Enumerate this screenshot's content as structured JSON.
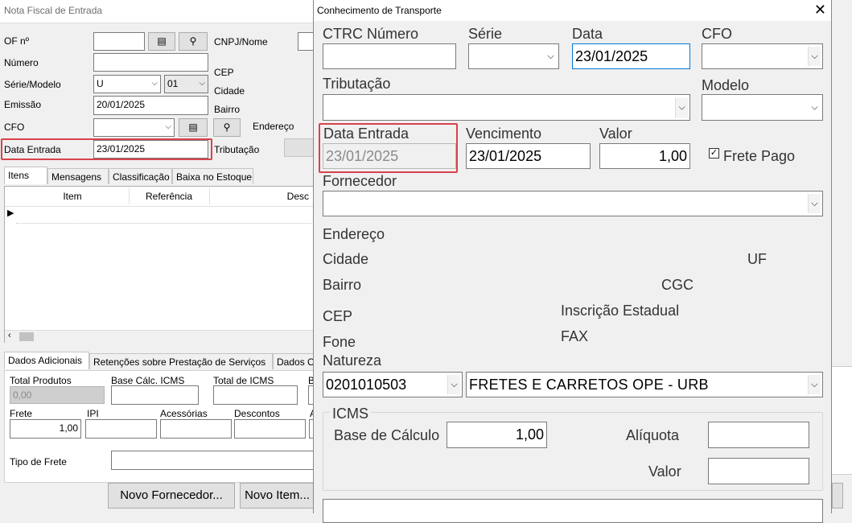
{
  "bg": {
    "title": "Nota Fiscal de Entrada",
    "of_label": "OF nº",
    "numero_label": "Número",
    "serie_label": "Série/Modelo",
    "serie_value": "U",
    "modelo_value": "01",
    "emissao_label": "Emissão",
    "emissao_value": "20/01/2025",
    "cfo_label": "CFO",
    "data_entrada_label": "Data Entrada",
    "data_entrada_value": "23/01/2025",
    "cnpj_label": "CNPJ/Nome",
    "cep_label": "CEP",
    "cidade_label": "Cidade",
    "bairro_label": "Bairro",
    "endereco_label": "Endereço",
    "tributacao_label": "Tributação",
    "tabs": [
      "Itens",
      "Mensagens",
      "Classificação",
      "Baixa no Estoque"
    ],
    "grid_headers": [
      "Item",
      "Referência",
      "Desc"
    ],
    "bottom_tabs": [
      "Dados Adicionais",
      "Retenções sobre Prestação de Serviços",
      "Dados C"
    ],
    "total_produtos_label": "Total Produtos",
    "total_produtos_value": "0,00",
    "base_icms_label": "Base Cálc. ICMS",
    "total_icms_label": "Total de ICMS",
    "b_label": "B",
    "frete_label": "Frete",
    "frete_value": "1,00",
    "ipi_label": "IPI",
    "acessorias_label": "Acessórias",
    "descontos_label": "Descontos",
    "a_label": "A",
    "tipo_frete_label": "Tipo de Frete",
    "novo_fornecedor": "Novo Fornecedor...",
    "novo_item": "Novo Item..."
  },
  "dialog": {
    "title": "Conhecimento de Transporte",
    "close_glyph": "✕",
    "ctrc_label": "CTRC Número",
    "ctrc_value": "",
    "serie_label": "Série",
    "serie_value": "",
    "data_label": "Data",
    "data_value": "23/01/2025",
    "cfo_label": "CFO",
    "cfo_value": "",
    "tributacao_label": "Tributação",
    "modelo_label": "Modelo",
    "data_entrada_label": "Data Entrada",
    "data_entrada_value": "23/01/2025",
    "vencimento_label": "Vencimento",
    "vencimento_value": "23/01/2025",
    "valor_label": "Valor",
    "valor_value": "1,00",
    "frete_pago_label": "Frete Pago",
    "frete_pago_checked": true,
    "fornecedor_label": "Fornecedor",
    "endereco_label": "Endereço",
    "cidade_label": "Cidade",
    "uf_label": "UF",
    "bairro_label": "Bairro",
    "cgc_label": "CGC",
    "cep_label": "CEP",
    "inscricao_label": "Inscrição Estadual",
    "fone_label": "Fone",
    "fax_label": "FAX",
    "natureza_label": "Natureza",
    "natureza_code": "0201010503",
    "natureza_desc": "FRETES E CARRETOS OPE - URB",
    "icms_group_label": "ICMS",
    "base_calculo_label": "Base de Cálculo",
    "base_calculo_value": "1,00",
    "aliquota_label": "Alíquota",
    "aliquota_value": "",
    "valor_icms_label": "Valor",
    "valor_icms_value": ""
  },
  "colors": {
    "highlight": "#d7434b"
  }
}
